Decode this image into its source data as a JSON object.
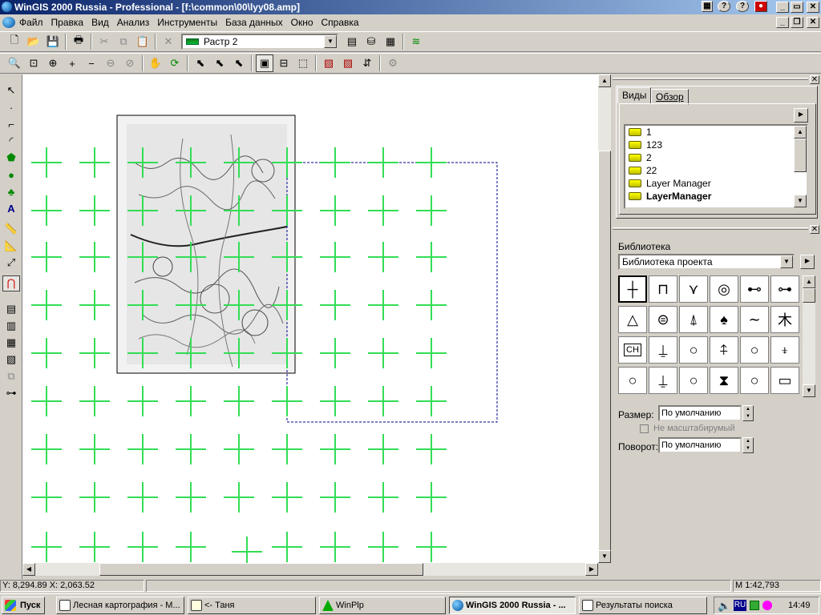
{
  "window": {
    "title": "WinGIS 2000 Russia - Professional - [f:\\common\\00\\lyy08.amp]"
  },
  "menu": [
    "Файл",
    "Правка",
    "Вид",
    "Анализ",
    "Инструменты",
    "База данных",
    "Окно",
    "Справка"
  ],
  "toolbar": {
    "layer_combo": "Растр 2"
  },
  "views_panel": {
    "tabs": [
      "Виды",
      "Обзор"
    ],
    "items": [
      "1",
      "123",
      "2",
      "22",
      "Layer Manager",
      "LayerManager"
    ]
  },
  "library_panel": {
    "title": "Библиотека",
    "combo": "Библиотека проекта",
    "symbols": [
      "cross-symbol",
      "bracket-symbol",
      "pipeline-symbol",
      "target-symbol",
      "pump-symbol",
      "pump-symbol-2",
      "triangle-hatched-symbol",
      "circle-dashed-symbol",
      "tower-symbol",
      "deciduous-tree-symbol",
      "wave-symbol",
      "conifer-symbol",
      "ch-label-symbol",
      "tree-symbol",
      "circle-symbol",
      "tree-symbol-2",
      "circle-symbol-2",
      "tree-symbol-3",
      "circle-symbol-3",
      "tree-symbol-4",
      "circle-symbol-4",
      "shrub-symbol",
      "circle-symbol-5",
      "wall-symbol"
    ],
    "symbol_ch_text": "CH",
    "size_label": "Размер:",
    "size_value": "По умолчанию",
    "noscale_label": "Не масштабирумый",
    "rotation_label": "Поворот:",
    "rotation_value": "По умолчанию"
  },
  "statusbar": {
    "coords": "Y: 8,294.89 X: 2,063.52",
    "scale": "M 1:42,793"
  },
  "taskbar": {
    "start": "Пуск",
    "tasks": [
      "Лесная картография - M...",
      "<- Таня",
      "WinPlp",
      "WinGIS 2000 Russia - ...",
      "Результаты поиска"
    ],
    "lang": "RU",
    "clock": "14:49"
  },
  "colors": {
    "grid_cross": "#33dd55",
    "title_start": "#0a246a",
    "title_end": "#a6caf0"
  }
}
